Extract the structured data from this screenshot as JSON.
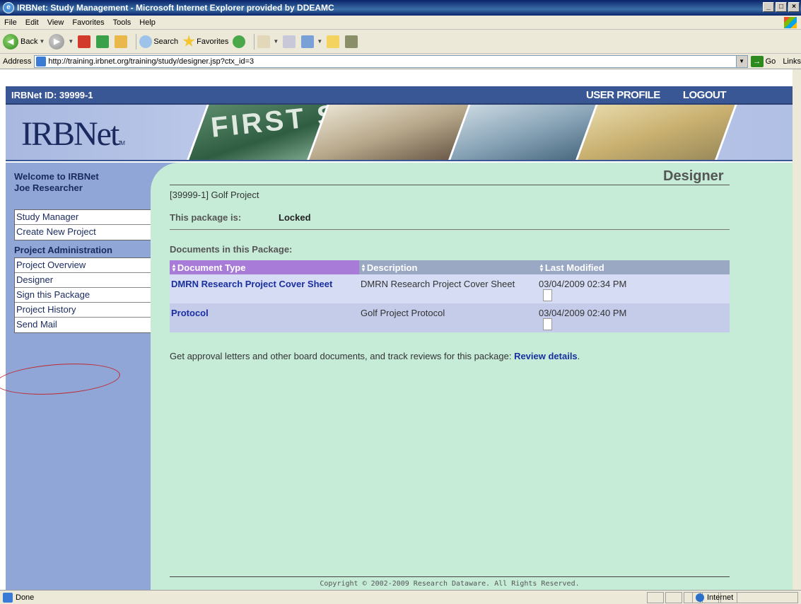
{
  "window": {
    "title": "IRBNet: Study Management - Microsoft Internet Explorer provided by DDEAMC"
  },
  "menu": [
    "File",
    "Edit",
    "View",
    "Favorites",
    "Tools",
    "Help"
  ],
  "toolbar": {
    "back": "Back",
    "search": "Search",
    "favorites": "Favorites"
  },
  "address": {
    "label": "Address",
    "url": "http://training.irbnet.org/training/study/designer.jsp?ctx_id=3",
    "go": "Go",
    "links": "Links"
  },
  "header": {
    "irbnet_id": "IRBNet ID: 39999-1",
    "user_profile": "USER PROFILE",
    "logout": "LOGOUT",
    "logo": "IRBNet",
    "logo_tm": "TM",
    "sign_text": "FIRST ST"
  },
  "sidebar": {
    "welcome_line1": "Welcome to IRBNet",
    "welcome_line2": "Joe Researcher",
    "items_top": [
      "Study Manager",
      "Create New Project"
    ],
    "section_title": "Project Administration",
    "items_admin": [
      "Project Overview",
      "Designer",
      "Sign this Package",
      "Project History",
      "Send Mail"
    ]
  },
  "main": {
    "page_title": "Designer",
    "project_name": "[39999-1] Golf Project",
    "package_label": "This package is:",
    "package_status": "Locked",
    "docs_label": "Documents in this Package:",
    "table": {
      "headers": [
        "Document Type",
        "Description",
        "Last Modified"
      ],
      "rows": [
        {
          "type": "DMRN Research Project Cover Sheet",
          "description": "DMRN Research Project Cover Sheet",
          "modified": "03/04/2009 02:34 PM"
        },
        {
          "type": "Protocol",
          "description": "Golf Project Protocol",
          "modified": "03/04/2009 02:40 PM"
        }
      ]
    },
    "review_text": "Get approval letters and other board documents, and track reviews for this package:",
    "review_link": "Review details",
    "review_period": ".",
    "copyright": "Copyright © 2002-2009 Research Dataware. All Rights Reserved."
  },
  "status": {
    "text": "Done",
    "zone": "Internet"
  },
  "colors": {
    "header_bar": "#3a5795",
    "sidebar": "#8fa6d7",
    "content": "#c6ecd8",
    "link": "#1a2fa0",
    "annotation": "#c0282d"
  }
}
